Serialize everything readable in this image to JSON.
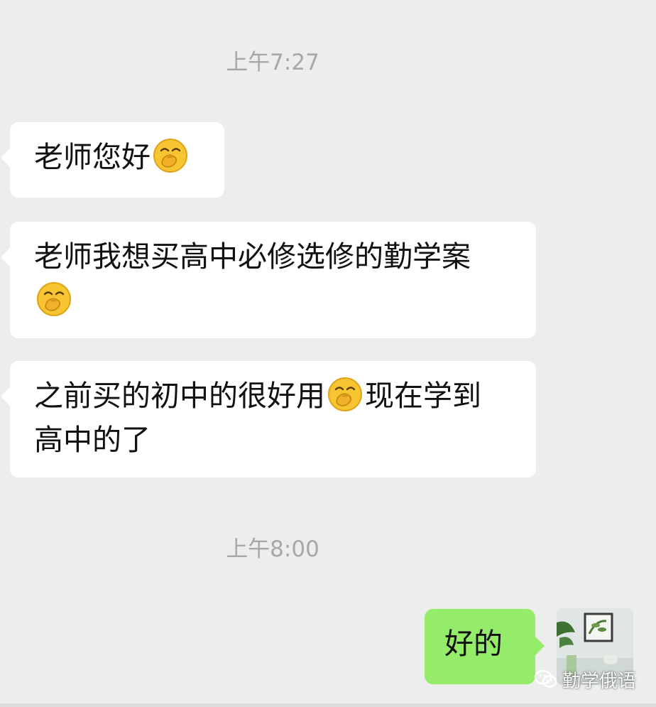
{
  "chat": {
    "timestamps": [
      "上午7:27",
      "上午8:00"
    ],
    "incoming_messages": [
      {
        "parts": [
          "老师您好"
        ],
        "emoji": "thinking-hand-over-mouth-emoji"
      },
      {
        "line1": "老师我想买高中必修选修的勤学案",
        "emoji": "thinking-hand-over-mouth-emoji"
      },
      {
        "part1": "之前买的初中的很好用",
        "emoji": "thinking-hand-over-mouth-emoji",
        "part2": "现在学到",
        "line2": "高中的了"
      }
    ],
    "outgoing_messages": [
      {
        "text": "好的"
      }
    ]
  },
  "watermark": {
    "text": "勤学俄语",
    "icon": "wechat-icon"
  },
  "colors": {
    "background": "#ededed",
    "incoming_bubble": "#ffffff",
    "outgoing_bubble": "#95ec69",
    "timestamp_text": "#a7a7a7"
  }
}
